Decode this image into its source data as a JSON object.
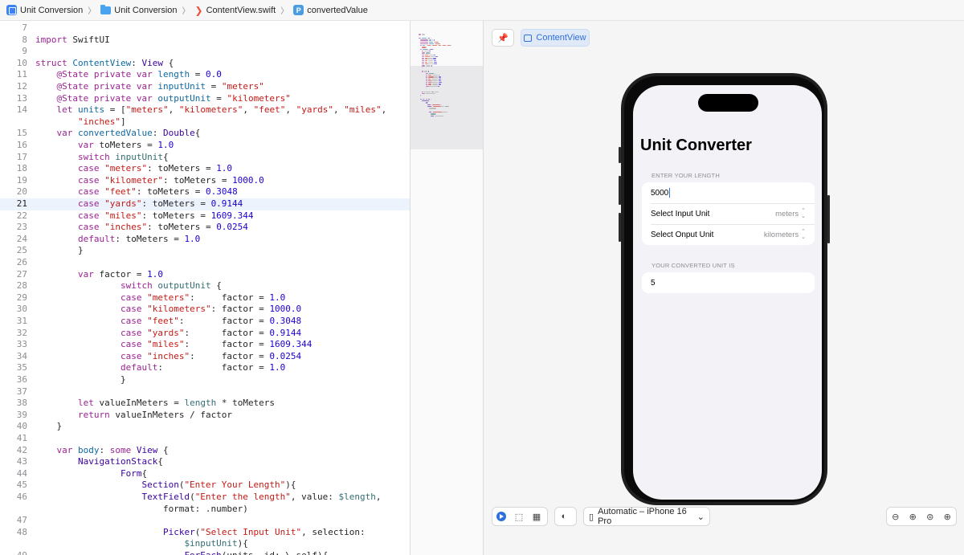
{
  "jumpbar": {
    "items": [
      "Unit Conversion",
      "Unit Conversion",
      "ContentView.swift",
      "convertedValue"
    ]
  },
  "editor": {
    "current_line": "21",
    "lines": [
      {
        "n": "7",
        "tokens": []
      },
      {
        "n": "8",
        "tokens": [
          [
            "kw",
            "import"
          ],
          [
            "p",
            " SwiftUI"
          ]
        ]
      },
      {
        "n": "9",
        "tokens": []
      },
      {
        "n": "10",
        "tokens": [
          [
            "kw",
            "struct"
          ],
          [
            "p",
            " "
          ],
          [
            "id",
            "ContentView"
          ],
          [
            "p",
            ": "
          ],
          [
            "ty",
            "View"
          ],
          [
            "p",
            " {"
          ]
        ]
      },
      {
        "n": "11",
        "tokens": [
          [
            "p",
            "    "
          ],
          [
            "kw",
            "@State private var"
          ],
          [
            "p",
            " "
          ],
          [
            "id",
            "length"
          ],
          [
            "p",
            " = "
          ],
          [
            "num",
            "0.0"
          ]
        ]
      },
      {
        "n": "12",
        "tokens": [
          [
            "p",
            "    "
          ],
          [
            "kw",
            "@State private var"
          ],
          [
            "p",
            " "
          ],
          [
            "id",
            "inputUnit"
          ],
          [
            "p",
            " = "
          ],
          [
            "str",
            "\"meters\""
          ]
        ]
      },
      {
        "n": "13",
        "tokens": [
          [
            "p",
            "    "
          ],
          [
            "kw",
            "@State private var"
          ],
          [
            "p",
            " "
          ],
          [
            "id",
            "outputUnit"
          ],
          [
            "p",
            " = "
          ],
          [
            "str",
            "\"kilometers\""
          ]
        ]
      },
      {
        "n": "14",
        "tokens": [
          [
            "p",
            "    "
          ],
          [
            "kw",
            "let"
          ],
          [
            "p",
            " "
          ],
          [
            "id",
            "units"
          ],
          [
            "p",
            " = ["
          ],
          [
            "str",
            "\"meters\""
          ],
          [
            "p",
            ", "
          ],
          [
            "str",
            "\"kilometers\""
          ],
          [
            "p",
            ", "
          ],
          [
            "str",
            "\"feet\""
          ],
          [
            "p",
            ", "
          ],
          [
            "str",
            "\"yards\""
          ],
          [
            "p",
            ", "
          ],
          [
            "str",
            "\"miles\""
          ],
          [
            "p",
            ","
          ]
        ]
      },
      {
        "n": "",
        "tokens": [
          [
            "p",
            "        "
          ],
          [
            "str",
            "\"inches\""
          ],
          [
            "p",
            "]"
          ]
        ]
      },
      {
        "n": "15",
        "tokens": [
          [
            "p",
            "    "
          ],
          [
            "kw",
            "var"
          ],
          [
            "p",
            " "
          ],
          [
            "id",
            "convertedValue"
          ],
          [
            "p",
            ": "
          ],
          [
            "ty",
            "Double"
          ],
          [
            "p",
            "{"
          ]
        ]
      },
      {
        "n": "16",
        "tokens": [
          [
            "p",
            "        "
          ],
          [
            "kw",
            "var"
          ],
          [
            "p",
            " toMeters = "
          ],
          [
            "num",
            "1.0"
          ]
        ]
      },
      {
        "n": "17",
        "tokens": [
          [
            "p",
            "        "
          ],
          [
            "kw",
            "switch"
          ],
          [
            "p",
            " "
          ],
          [
            "vr",
            "inputUnit"
          ],
          [
            "p",
            "{"
          ]
        ]
      },
      {
        "n": "18",
        "tokens": [
          [
            "p",
            "        "
          ],
          [
            "kw",
            "case"
          ],
          [
            "p",
            " "
          ],
          [
            "str",
            "\"meters\""
          ],
          [
            "p",
            ": toMeters = "
          ],
          [
            "num",
            "1.0"
          ]
        ]
      },
      {
        "n": "19",
        "tokens": [
          [
            "p",
            "        "
          ],
          [
            "kw",
            "case"
          ],
          [
            "p",
            " "
          ],
          [
            "str",
            "\"kilometer\""
          ],
          [
            "p",
            ": toMeters = "
          ],
          [
            "num",
            "1000.0"
          ]
        ]
      },
      {
        "n": "20",
        "tokens": [
          [
            "p",
            "        "
          ],
          [
            "kw",
            "case"
          ],
          [
            "p",
            " "
          ],
          [
            "str",
            "\"feet\""
          ],
          [
            "p",
            ": toMeters = "
          ],
          [
            "num",
            "0.3048"
          ]
        ]
      },
      {
        "n": "21",
        "tokens": [
          [
            "p",
            "        "
          ],
          [
            "kw",
            "case"
          ],
          [
            "p",
            " "
          ],
          [
            "str",
            "\"yards\""
          ],
          [
            "p",
            ": toMeters = "
          ],
          [
            "num",
            "0.9144"
          ]
        ]
      },
      {
        "n": "22",
        "tokens": [
          [
            "p",
            "        "
          ],
          [
            "kw",
            "case"
          ],
          [
            "p",
            " "
          ],
          [
            "str",
            "\"miles\""
          ],
          [
            "p",
            ": toMeters = "
          ],
          [
            "num",
            "1609.344"
          ]
        ]
      },
      {
        "n": "23",
        "tokens": [
          [
            "p",
            "        "
          ],
          [
            "kw",
            "case"
          ],
          [
            "p",
            " "
          ],
          [
            "str",
            "\"inches\""
          ],
          [
            "p",
            ": toMeters = "
          ],
          [
            "num",
            "0.0254"
          ]
        ]
      },
      {
        "n": "24",
        "tokens": [
          [
            "p",
            "        "
          ],
          [
            "kw",
            "default"
          ],
          [
            "p",
            ": toMeters = "
          ],
          [
            "num",
            "1.0"
          ]
        ]
      },
      {
        "n": "25",
        "tokens": [
          [
            "p",
            "        }"
          ]
        ]
      },
      {
        "n": "26",
        "tokens": []
      },
      {
        "n": "27",
        "tokens": [
          [
            "p",
            "        "
          ],
          [
            "kw",
            "var"
          ],
          [
            "p",
            " factor = "
          ],
          [
            "num",
            "1.0"
          ]
        ]
      },
      {
        "n": "28",
        "tokens": [
          [
            "p",
            "                "
          ],
          [
            "kw",
            "switch"
          ],
          [
            "p",
            " "
          ],
          [
            "vr",
            "outputUnit"
          ],
          [
            "p",
            " {"
          ]
        ]
      },
      {
        "n": "29",
        "tokens": [
          [
            "p",
            "                "
          ],
          [
            "kw",
            "case"
          ],
          [
            "p",
            " "
          ],
          [
            "str",
            "\"meters\""
          ],
          [
            "p",
            ":     factor = "
          ],
          [
            "num",
            "1.0"
          ]
        ]
      },
      {
        "n": "30",
        "tokens": [
          [
            "p",
            "                "
          ],
          [
            "kw",
            "case"
          ],
          [
            "p",
            " "
          ],
          [
            "str",
            "\"kilometers\""
          ],
          [
            "p",
            ": factor = "
          ],
          [
            "num",
            "1000.0"
          ]
        ]
      },
      {
        "n": "31",
        "tokens": [
          [
            "p",
            "                "
          ],
          [
            "kw",
            "case"
          ],
          [
            "p",
            " "
          ],
          [
            "str",
            "\"feet\""
          ],
          [
            "p",
            ":       factor = "
          ],
          [
            "num",
            "0.3048"
          ]
        ]
      },
      {
        "n": "32",
        "tokens": [
          [
            "p",
            "                "
          ],
          [
            "kw",
            "case"
          ],
          [
            "p",
            " "
          ],
          [
            "str",
            "\"yards\""
          ],
          [
            "p",
            ":      factor = "
          ],
          [
            "num",
            "0.9144"
          ]
        ]
      },
      {
        "n": "33",
        "tokens": [
          [
            "p",
            "                "
          ],
          [
            "kw",
            "case"
          ],
          [
            "p",
            " "
          ],
          [
            "str",
            "\"miles\""
          ],
          [
            "p",
            ":      factor = "
          ],
          [
            "num",
            "1609.344"
          ]
        ]
      },
      {
        "n": "34",
        "tokens": [
          [
            "p",
            "                "
          ],
          [
            "kw",
            "case"
          ],
          [
            "p",
            " "
          ],
          [
            "str",
            "\"inches\""
          ],
          [
            "p",
            ":     factor = "
          ],
          [
            "num",
            "0.0254"
          ]
        ]
      },
      {
        "n": "35",
        "tokens": [
          [
            "p",
            "                "
          ],
          [
            "kw",
            "default"
          ],
          [
            "p",
            ":           factor = "
          ],
          [
            "num",
            "1.0"
          ]
        ]
      },
      {
        "n": "36",
        "tokens": [
          [
            "p",
            "                }"
          ]
        ]
      },
      {
        "n": "37",
        "tokens": []
      },
      {
        "n": "38",
        "tokens": [
          [
            "p",
            "        "
          ],
          [
            "kw",
            "let"
          ],
          [
            "p",
            " valueInMeters = "
          ],
          [
            "vr",
            "length"
          ],
          [
            "p",
            " * toMeters"
          ]
        ]
      },
      {
        "n": "39",
        "tokens": [
          [
            "p",
            "        "
          ],
          [
            "kw",
            "return"
          ],
          [
            "p",
            " valueInMeters / factor"
          ]
        ]
      },
      {
        "n": "40",
        "tokens": [
          [
            "p",
            "    }"
          ]
        ]
      },
      {
        "n": "41",
        "tokens": []
      },
      {
        "n": "42",
        "tokens": [
          [
            "p",
            "    "
          ],
          [
            "kw",
            "var"
          ],
          [
            "p",
            " "
          ],
          [
            "id",
            "body"
          ],
          [
            "p",
            ": "
          ],
          [
            "kw",
            "some"
          ],
          [
            "p",
            " "
          ],
          [
            "ty",
            "View"
          ],
          [
            "p",
            " {"
          ]
        ]
      },
      {
        "n": "43",
        "tokens": [
          [
            "p",
            "        "
          ],
          [
            "ty",
            "NavigationStack"
          ],
          [
            "p",
            "{"
          ]
        ]
      },
      {
        "n": "44",
        "tokens": [
          [
            "p",
            "                "
          ],
          [
            "ty",
            "Form"
          ],
          [
            "p",
            "{"
          ]
        ]
      },
      {
        "n": "45",
        "tokens": [
          [
            "p",
            "                    "
          ],
          [
            "ty",
            "Section"
          ],
          [
            "p",
            "("
          ],
          [
            "str",
            "\"Enter Your Length\""
          ],
          [
            "p",
            "){"
          ]
        ]
      },
      {
        "n": "46",
        "tokens": [
          [
            "p",
            "                    "
          ],
          [
            "ty",
            "TextField"
          ],
          [
            "p",
            "("
          ],
          [
            "str",
            "\"Enter the length\""
          ],
          [
            "p",
            ", value: "
          ],
          [
            "vr",
            "$length"
          ],
          [
            "p",
            ","
          ]
        ]
      },
      {
        "n": "",
        "tokens": [
          [
            "p",
            "                        format: .number)"
          ]
        ]
      },
      {
        "n": "47",
        "tokens": []
      },
      {
        "n": "48",
        "tokens": [
          [
            "p",
            "                        "
          ],
          [
            "ty",
            "Picker"
          ],
          [
            "p",
            "("
          ],
          [
            "str",
            "\"Select Input Unit\""
          ],
          [
            "p",
            ", selection:"
          ]
        ]
      },
      {
        "n": "",
        "tokens": [
          [
            "p",
            "                            "
          ],
          [
            "vr",
            "$inputUnit"
          ],
          [
            "p",
            "){"
          ]
        ]
      },
      {
        "n": "49",
        "tokens": [
          [
            "p",
            "                            "
          ],
          [
            "ty",
            "ForEach"
          ],
          [
            "p",
            "(units, id: \\.self){"
          ]
        ]
      }
    ]
  },
  "canvas": {
    "preview_tab": "ContentView",
    "pin_icon": "pin-icon",
    "device_selector": "Automatic – iPhone 16 Pro",
    "app": {
      "nav_title": "Unit Converter",
      "section1_header": "ENTER YOUR LENGTH",
      "length_value": "5000",
      "input_picker_label": "Select Input Unit",
      "input_picker_value": "meters",
      "output_picker_label": "Select Onput Unit",
      "output_picker_value": "kilometers",
      "section2_header": "YOUR CONVERTED UNIT IS",
      "result_value": "5"
    }
  },
  "colors": {
    "keyword": "#9b2393",
    "type": "#3900a0",
    "string": "#c41a16",
    "number": "#1c00cf",
    "identifier": "#0f68a0",
    "variable": "#326d74",
    "accent": "#2f6fdb",
    "current_line_bg": "#edf3fd"
  }
}
